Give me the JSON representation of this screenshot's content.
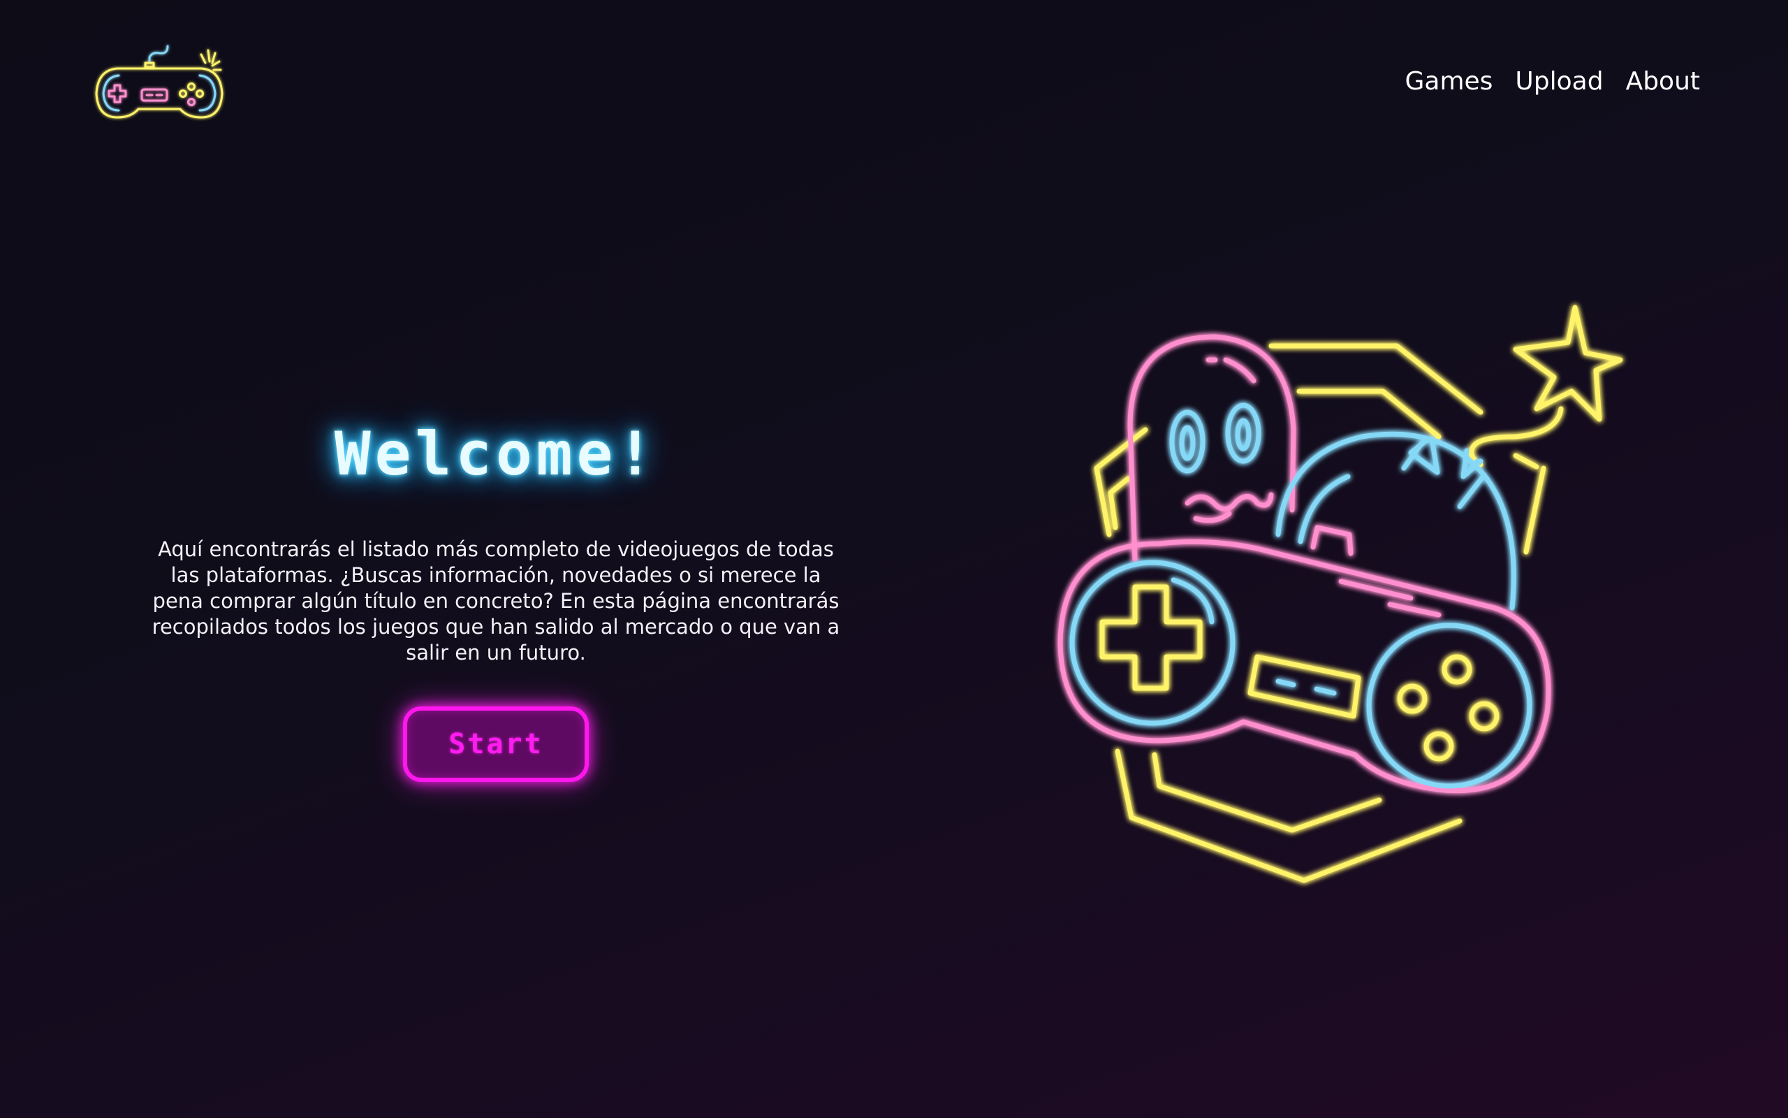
{
  "header": {
    "logo_icon": "gamepad-logo-icon",
    "nav": [
      {
        "label": "Games"
      },
      {
        "label": "Upload"
      },
      {
        "label": "About"
      }
    ]
  },
  "hero": {
    "title": "Welcome!",
    "description": "Aquí encontrarás el listado más completo de videojuegos de todas las plataformas. ¿Buscas información, novedades o si merece la pena comprar algún título en concreto? En esta página encontrarás recopilados todos los juegos que han salido al mercado o que van a salir en un futuro.",
    "start_label": "Start"
  },
  "illustration": {
    "icon": "neon-gamepad-ghost-bomb-illustration"
  },
  "colors": {
    "neon_yellow": "#fff36b",
    "neon_pink": "#ff8fce",
    "neon_blue": "#86d8f7",
    "neon_magenta": "#ff17ee",
    "title_glow": "#3fc8ff"
  }
}
